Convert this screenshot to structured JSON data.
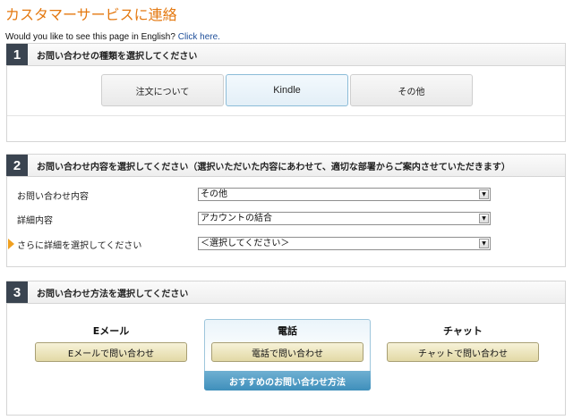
{
  "page": {
    "title": "カスタマーサービスに連絡",
    "lang_prompt": "Would you like to see this page in English?",
    "lang_link": "Click here."
  },
  "step1": {
    "number": "1",
    "title": "お問い合わせの種類を選択してください",
    "options": [
      "注文について",
      "Kindle",
      "その他"
    ],
    "selected": "Kindle"
  },
  "step2": {
    "number": "2",
    "title": "お問い合わせ内容を選択してください（選択いただいた内容にあわせて、適切な部署からご案内させていただきます）",
    "rows": [
      {
        "label": "お問い合わせ内容",
        "value": "その他"
      },
      {
        "label": "詳細内容",
        "value": "アカウントの結合"
      },
      {
        "label": "さらに詳細を選択してください",
        "value": "＜選択してください＞"
      }
    ]
  },
  "step3": {
    "number": "3",
    "title": "お問い合わせ方法を選択してください",
    "methods": [
      {
        "heading": "Eメール",
        "button": "Eメールで問い合わせ"
      },
      {
        "heading": "電話",
        "button": "電話で問い合わせ"
      },
      {
        "heading": "チャット",
        "button": "チャットで問い合わせ"
      }
    ],
    "recommended_label": "おすすめのお問い合わせ方法"
  },
  "colors": {
    "title_orange": "#e47911",
    "link_blue": "#1f4f9a",
    "step_badge": "#3a4450",
    "recommended_blue": "#4a98c4"
  }
}
